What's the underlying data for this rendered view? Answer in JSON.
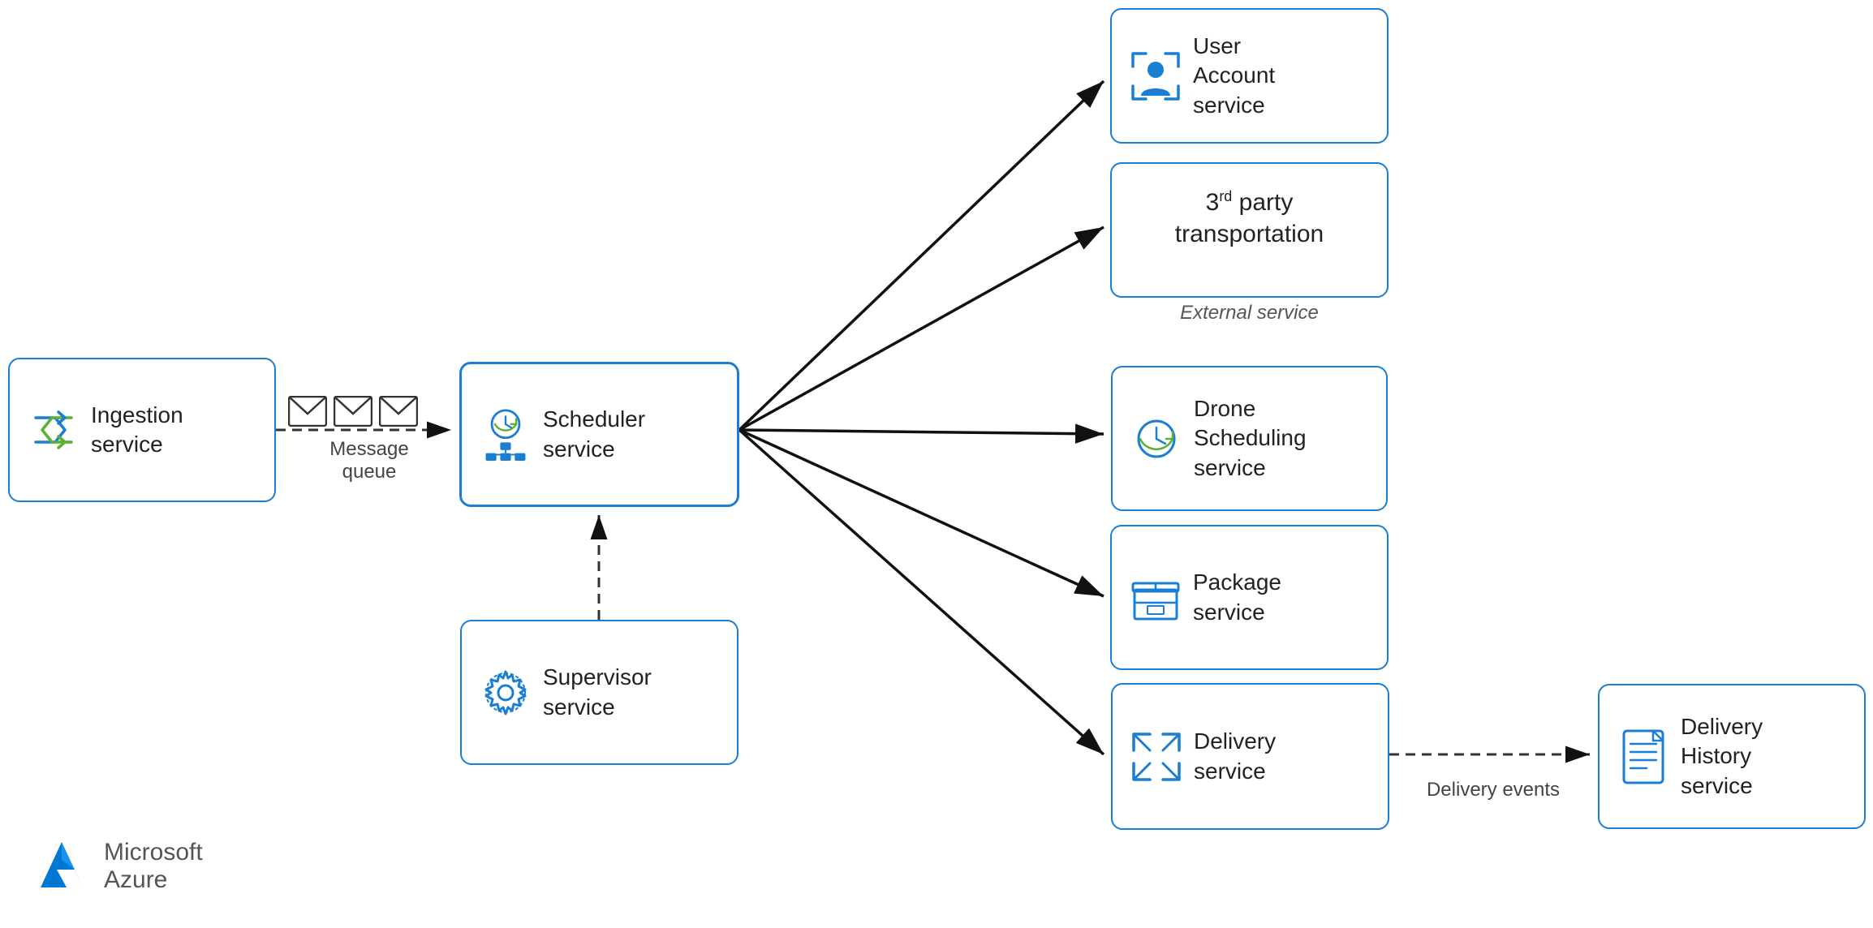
{
  "services": {
    "ingestion": {
      "label": "Ingestion\nservice",
      "id": "ingestion"
    },
    "scheduler": {
      "label": "Scheduler\nservice",
      "id": "scheduler"
    },
    "supervisor": {
      "label": "Supervisor\nservice",
      "id": "supervisor"
    },
    "user_account": {
      "label": "User\nAccount\nservice",
      "id": "user_account"
    },
    "third_party": {
      "label": "3rd party\ntransportation",
      "id": "third_party"
    },
    "drone_scheduling": {
      "label": "Drone\nScheduling\nservice",
      "id": "drone_scheduling"
    },
    "package": {
      "label": "Package\nservice",
      "id": "package"
    },
    "delivery": {
      "label": "Delivery\nservice",
      "id": "delivery"
    },
    "delivery_history": {
      "label": "Delivery\nHistory\nservice",
      "id": "delivery_history"
    }
  },
  "labels": {
    "message_queue": "Message\nqueue",
    "external_service": "External service",
    "delivery_events": "Delivery events",
    "third_party_sup": "rd"
  },
  "azure": {
    "line1": "Microsoft",
    "line2": "Azure"
  }
}
